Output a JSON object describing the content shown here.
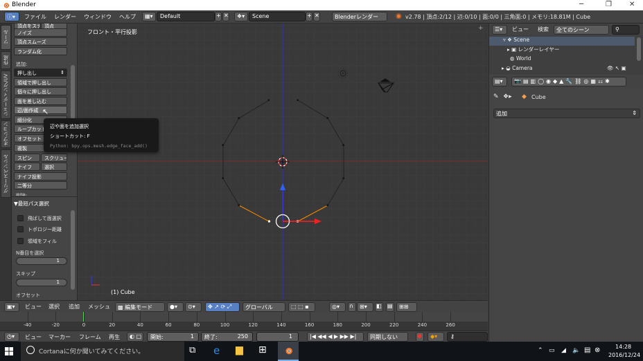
{
  "window": {
    "title": "Blender",
    "controls": [
      "─",
      "❐",
      "✕"
    ]
  },
  "infobar": {
    "menus": [
      "ファイル",
      "レンダー",
      "ウィンドウ",
      "ヘルプ"
    ],
    "layout": "Default",
    "scene": "Scene",
    "engine": "Blenderレンダー",
    "stats": "v2.78 | 頂点:2/12 | 辺:0/10 | 面:0/0 | 三角面:0 | メモリ:18.81M | Cube"
  },
  "lefttabs": [
    "ツール",
    "作成",
    "シェーディング/UV",
    "オプション",
    "グリースペンシル"
  ],
  "toolshelf": {
    "top_items": [
      "ノイズ",
      "頂点スムーズ",
      "ランダム化"
    ],
    "top_clipped": [
      "頂点をスナップ",
      "頂点"
    ],
    "add_label": "追加:",
    "add_items": [
      "押し出し",
      "領域で押し出し",
      "個々に押し出し",
      "面を差し込む",
      "辺/面作成",
      "細分化",
      "ループカット",
      "オフセット",
      "複製"
    ],
    "pair1": [
      "スピン",
      "スクリュー"
    ],
    "pair2": [
      "ナイフ",
      "選択"
    ],
    "after_items": [
      "ナイフ投影",
      "二等分"
    ],
    "extra_clipped": "削除:",
    "panel_title": "▼最短パス選択",
    "checks": [
      "飛ばして面選択",
      "トポロジー距離",
      "領域をフィル"
    ],
    "nth_label": "N番目を選択",
    "nth_value": "1",
    "skip_label": "スキップ",
    "skip_value": "1",
    "offset_label": "オフセット"
  },
  "tooltip": {
    "title": "辺や面を追加選択",
    "shortcut": "ショートカット: F",
    "python": "Python: bpy.ops.mesh.edge_face_add()"
  },
  "viewport": {
    "view_label": "フロント・平行投影",
    "object_label": "(1) Cube"
  },
  "vpheader": {
    "menus": [
      "ビュー",
      "選択",
      "追加",
      "メッシュ"
    ],
    "mode": "編集モード",
    "orientation": "グローバル"
  },
  "timeline": {
    "ticks": [
      -40,
      -20,
      0,
      20,
      40,
      60,
      80,
      100,
      120,
      140,
      160,
      180,
      200,
      220,
      240,
      260
    ],
    "current_frame_marker": 0
  },
  "tlheader": {
    "menus": [
      "ビュー",
      "マーカー",
      "フレーム",
      "再生"
    ],
    "start": "開始:",
    "start_val": "1",
    "end": "終了:",
    "end_val": "250",
    "current": "1",
    "sync": "同期しない"
  },
  "outliner": {
    "view": "ビュー",
    "search": "検索",
    "filter": "全てのシーン",
    "rows": [
      "Scene",
      "レンダーレイヤー",
      "World",
      "Camera"
    ]
  },
  "props": {
    "object": "Cube",
    "add": "追加"
  },
  "taskbar": {
    "search": "Cortanaに何か聞いてみてください。",
    "time": "14:28",
    "date": "2016/12/24"
  },
  "colors": {
    "accent": "#5680c2",
    "vertex": "#ff8c00",
    "axis_x": "#ff3030",
    "axis_z": "#3030ff"
  }
}
